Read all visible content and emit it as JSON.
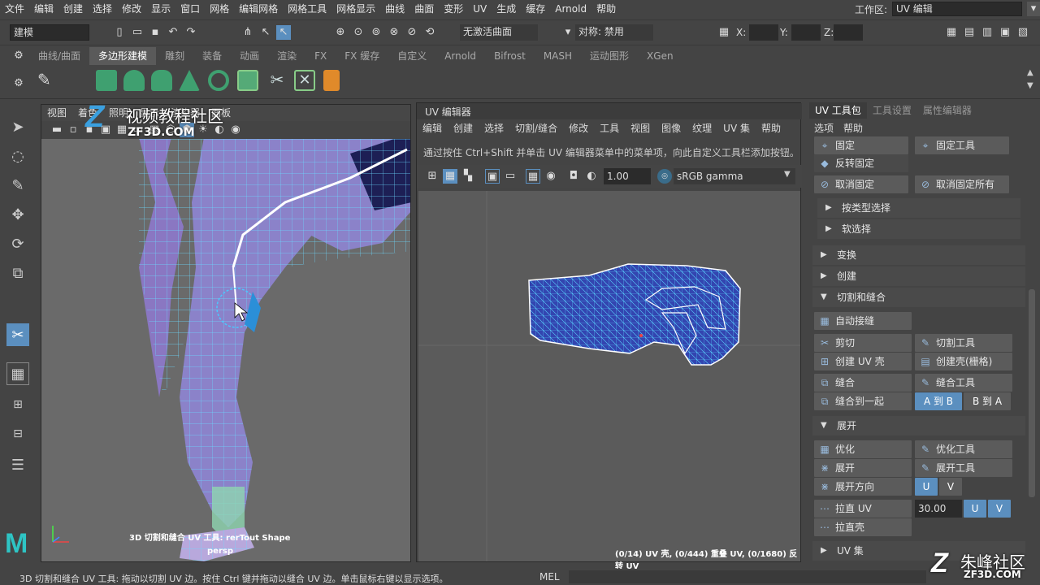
{
  "menu": [
    "文件",
    "编辑",
    "创建",
    "选择",
    "修改",
    "显示",
    "窗口",
    "网格",
    "编辑网格",
    "网格工具",
    "网格显示",
    "曲线",
    "曲面",
    "变形",
    "UV",
    "生成",
    "缓存",
    "Arnold",
    "帮助"
  ],
  "workspace": {
    "label": "工作区:",
    "value": "UV 编辑"
  },
  "status": {
    "mode": "建模",
    "live": "无激活曲面",
    "symmetry": "对称: 禁用",
    "x_label": "X:",
    "y_label": "Y:",
    "z_label": "Z:"
  },
  "shelf_tabs": [
    "曲线/曲面",
    "多边形建模",
    "雕刻",
    "装备",
    "动画",
    "渲染",
    "FX",
    "FX 缓存",
    "自定义",
    "Arnold",
    "Bifrost",
    "MASH",
    "运动图形",
    "XGen"
  ],
  "viewport": {
    "menu": [
      "视图",
      "着色",
      "照明",
      "显示",
      "渲染器",
      "面板"
    ],
    "hud_text": "3D 切割和缝合 UV 工具: rerTout Shape",
    "camera": "persp"
  },
  "watermark": {
    "title": "视频教程社区",
    "sub": "ZF3D.COM"
  },
  "uv_editor": {
    "title": "UV 编辑器",
    "menu": [
      "编辑",
      "创建",
      "选择",
      "切割/缝合",
      "修改",
      "工具",
      "视图",
      "图像",
      "纹理",
      "UV 集",
      "帮助"
    ],
    "hint": "通过按住 Ctrl+Shift 并单击 UV 编辑器菜单中的菜单项，向此自定义工具栏添加按钮。",
    "exposure": "1.00",
    "colorspace": "sRGB gamma",
    "stats": "(0/14) UV 壳, (0/444) 重叠 UV, (0/1680) 反转 UV"
  },
  "right_panel": {
    "tabs": [
      "UV 工具包",
      "工具设置",
      "属性编辑器"
    ],
    "menu": [
      "选项",
      "帮助"
    ],
    "pin": "固定",
    "pin_tool": "固定工具",
    "invert_pin": "反转固定",
    "unpin": "取消固定",
    "unpin_all": "取消固定所有",
    "sel_by_type": "按类型选择",
    "soft_sel": "软选择",
    "transform": "变换",
    "create": "创建",
    "cut_sew": "切割和缝合",
    "auto_seams": "自动接缝",
    "cut": "剪切",
    "cut_tool": "切割工具",
    "create_shell": "创建 UV 壳",
    "create_shell_grid": "创建壳(栅格)",
    "sew": "缝合",
    "sew_tool": "缝合工具",
    "sew_together": "缝合到一起",
    "a_to_b": "A 到 B",
    "b_to_a": "B 到 A",
    "unfold": "展开",
    "optimize": "优化",
    "optimize_tool": "优化工具",
    "unfold_btn": "展开",
    "unfold_tool": "展开工具",
    "unfold_dir": "展开方向",
    "u": "U",
    "v": "V",
    "straighten_uv": "拉直 UV",
    "angle": "30.00",
    "straighten_shell": "拉直壳",
    "uv_sets": "UV 集"
  },
  "help_line": "3D 切割和缝合 UV 工具: 拖动以切割 UV 边。按住 Ctrl 键并拖动以缝合 UV 边。单击鼠标右键以显示选项。",
  "cmd_label": "MEL",
  "brand": {
    "name": "朱峰社区",
    "url": "ZF3D.COM"
  },
  "colors": {
    "accent": "#5b8fbf",
    "active_tab": "#5a5a5a",
    "uv_wire": "#5ad8ff",
    "mesh_fill": "#7a6fbf"
  }
}
